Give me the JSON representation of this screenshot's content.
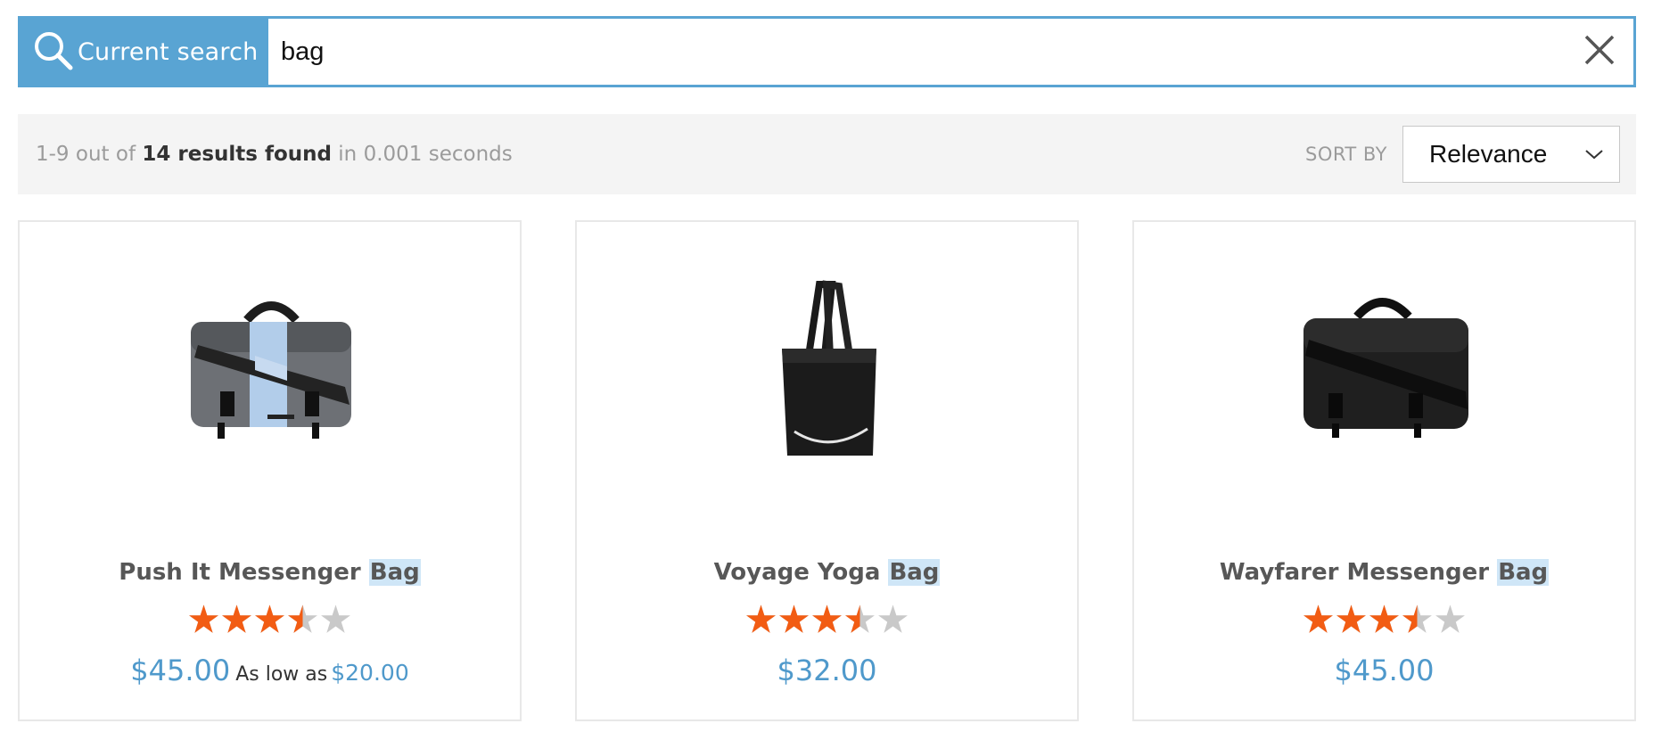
{
  "search": {
    "label": "Current search",
    "value": "bag",
    "clear_icon": "close-icon",
    "search_icon": "magnifier-icon"
  },
  "results": {
    "range": "1-9",
    "out_of": "out of",
    "count_text": "14 results found",
    "time_text": "in 0.001 seconds"
  },
  "sort": {
    "label": "SORT BY",
    "value": "Relevance",
    "icon": "chevron-down-icon"
  },
  "colors": {
    "accent": "#59a4d3",
    "price": "#4f99cb",
    "star_filled": "#f25c13",
    "star_empty": "#c9c9c9",
    "highlight": "#cfe6f7"
  },
  "products": [
    {
      "name_prefix": "Push It Messenger ",
      "name_match": "Bag",
      "rating_stars": 3.5,
      "rating_max": 5,
      "price": "$45.00",
      "as_low_as_label": "As low as",
      "as_low_as_price": "$20.00"
    },
    {
      "name_prefix": "Voyage Yoga ",
      "name_match": "Bag",
      "rating_stars": 3.5,
      "rating_max": 5,
      "price": "$32.00"
    },
    {
      "name_prefix": "Wayfarer Messenger ",
      "name_match": "Bag",
      "rating_stars": 3.5,
      "rating_max": 5,
      "price": "$45.00"
    }
  ]
}
